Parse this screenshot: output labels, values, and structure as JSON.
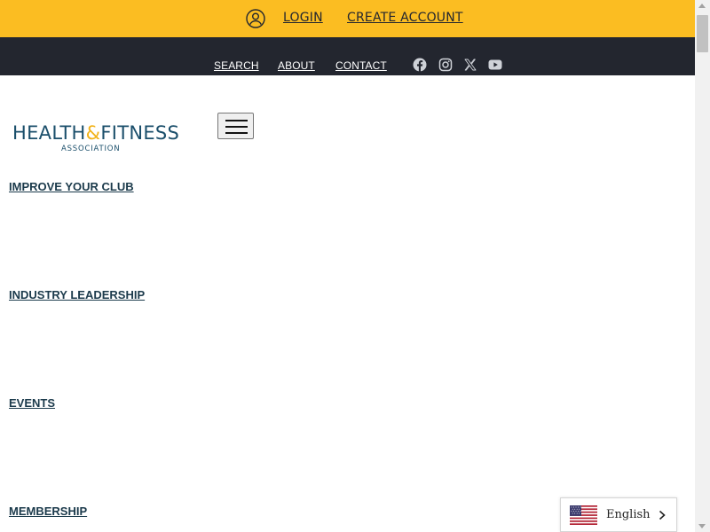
{
  "topbar": {
    "user_icon": "user-circle-icon",
    "login_label": "LOGIN",
    "create_account_label": "CREATE ACCOUNT",
    "background_color": "#fbbd22"
  },
  "utility_nav": {
    "search_label": "SEARCH",
    "about_label": "ABOUT",
    "contact_label": "CONTACT",
    "social_icons": [
      "facebook-icon",
      "instagram-icon",
      "x-icon",
      "youtube-icon"
    ],
    "background_color": "#23262f"
  },
  "logo": {
    "word_health": "HEALTH",
    "ampersand": "&",
    "word_fitness": "FITNESS",
    "subtitle": "ASSOCIATION",
    "brand_color": "#1b4f6b",
    "accent_color": "#f2b31a"
  },
  "menu_toggle": {
    "icon": "hamburger-menu-icon"
  },
  "main_nav": {
    "items": [
      {
        "label": "IMPROVE YOUR CLUB"
      },
      {
        "label": "INDUSTRY LEADERSHIP"
      },
      {
        "label": "EVENTS"
      },
      {
        "label": "MEMBERSHIP"
      }
    ]
  },
  "language_selector": {
    "flag_icon": "us-flag-icon",
    "selected": "English",
    "chevron_icon": "chevron-right-icon"
  }
}
